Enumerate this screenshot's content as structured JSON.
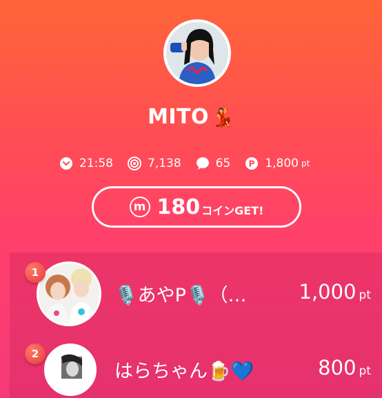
{
  "profile": {
    "name": "MITO",
    "name_emoji": "💃"
  },
  "stats": {
    "time": "21:58",
    "views": "7,138",
    "comments": "65",
    "points": "1,800",
    "points_unit": "pt"
  },
  "coin": {
    "icon_letter": "m",
    "amount": "180",
    "suffix": "コインGET!"
  },
  "ranking": [
    {
      "rank": "1",
      "name": "🎙️あやP🎙️（…",
      "points": "1,000",
      "unit": "pt"
    },
    {
      "rank": "2",
      "name": "はらちゃん🍺💙",
      "points": "800",
      "unit": "pt"
    }
  ],
  "icons": {
    "time": "chevron-down-circle-icon",
    "views": "eye-icon",
    "comments": "speech-bubble-icon",
    "points": "p-circle-icon",
    "coin": "m-coin-icon"
  },
  "colors": {
    "background_top": "#ff6538",
    "background_bottom": "#f43a78",
    "rank_badge": "#e83a38"
  }
}
